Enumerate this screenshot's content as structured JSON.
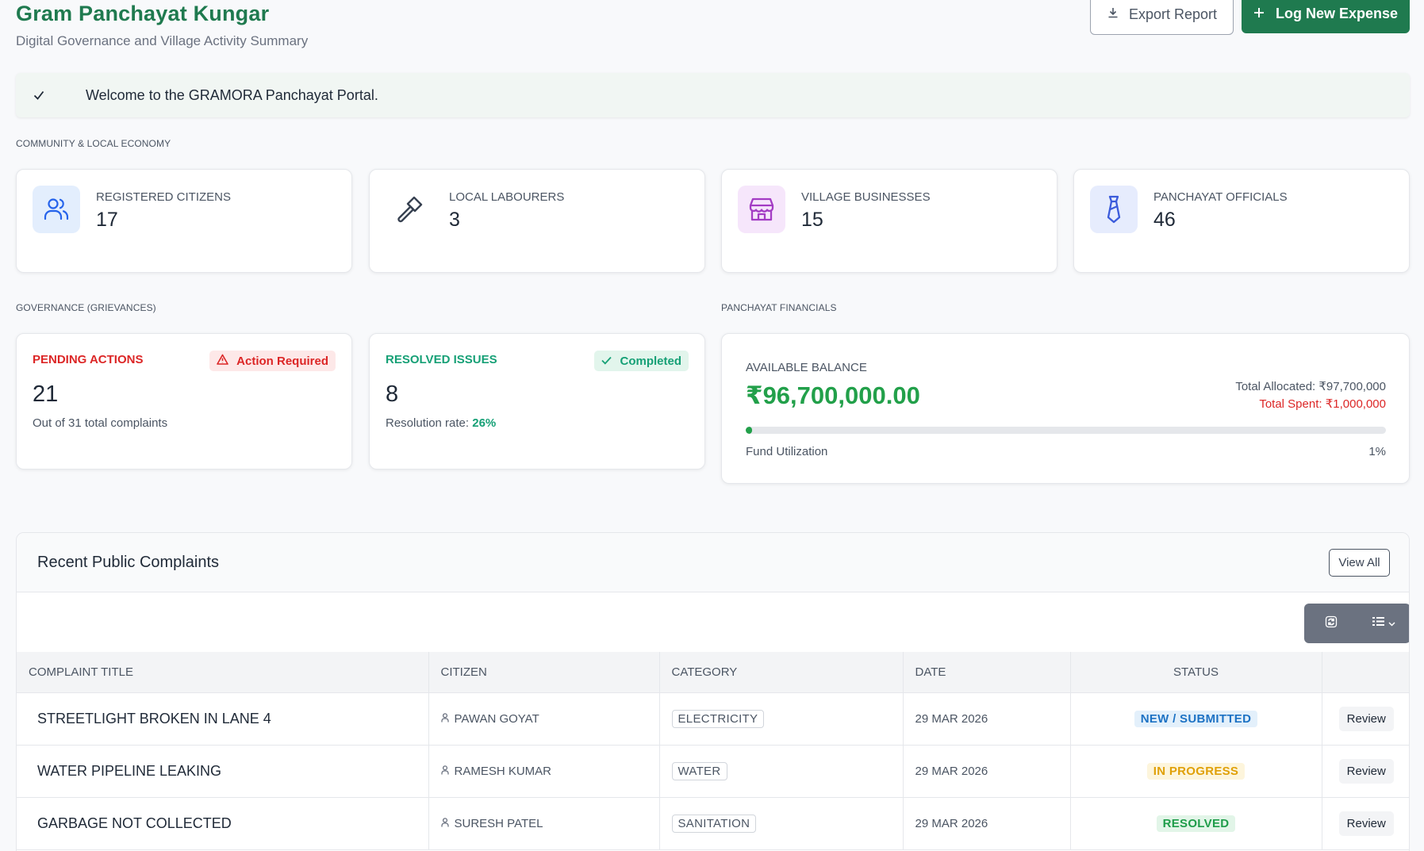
{
  "header": {
    "title": "Gram Panchayat Kungar",
    "subtitle": "Digital Governance and Village Activity Summary",
    "export_label": "Export Report",
    "log_expense_label": "Log New Expense"
  },
  "alert": {
    "message": "Welcome to the GRAMORA Panchayat Portal."
  },
  "community": {
    "section_label": "COMMUNITY & LOCAL ECONOMY",
    "cards": [
      {
        "label": "REGISTERED CITIZENS",
        "value": "17",
        "icon": "users-icon",
        "color": "#2563eb"
      },
      {
        "label": "LOCAL LABOURERS",
        "value": "3",
        "icon": "hammer-icon",
        "color": "#374151"
      },
      {
        "label": "VILLAGE BUSINESSES",
        "value": "15",
        "icon": "store-icon",
        "color": "#a33cc4"
      },
      {
        "label": "PANCHAYAT OFFICIALS",
        "value": "46",
        "icon": "tie-icon",
        "color": "#3b5bdb"
      }
    ]
  },
  "governance": {
    "section_label": "GOVERNANCE (GRIEVANCES)",
    "pending": {
      "label": "PENDING ACTIONS",
      "badge": "Action Required",
      "value": "21",
      "sub": "Out of 31 total complaints"
    },
    "resolved": {
      "label": "RESOLVED ISSUES",
      "badge": "Completed",
      "value": "8",
      "sub_prefix": "Resolution rate: ",
      "rate": "26%"
    }
  },
  "financials": {
    "section_label": "PANCHAYAT FINANCIALS",
    "balance_label": "AVAILABLE BALANCE",
    "balance": "₹96,700,000.00",
    "allocated": "Total Allocated: ₹97,700,000",
    "spent": "Total Spent: ₹1,000,000",
    "utilization_label": "Fund Utilization",
    "utilization_pct": "1%",
    "utilization_value": 1
  },
  "complaints": {
    "title": "Recent Public Complaints",
    "view_all_label": "View All",
    "columns": [
      "COMPLAINT TITLE",
      "CITIZEN",
      "CATEGORY",
      "DATE",
      "STATUS",
      ""
    ],
    "rows": [
      {
        "title": "STREETLIGHT BROKEN IN LANE 4",
        "citizen": "PAWAN GOYAT",
        "category": "ELECTRICITY",
        "date": "29 MAR 2026",
        "status": "NEW / SUBMITTED",
        "status_color": "#1d72c4",
        "status_bg": "#e3f0fb",
        "action": "Review"
      },
      {
        "title": "WATER PIPELINE LEAKING",
        "citizen": "RAMESH KUMAR",
        "category": "WATER",
        "date": "29 MAR 2026",
        "status": "IN PROGRESS",
        "status_color": "#e0a008",
        "status_bg": "#fdf5dc",
        "action": "Review"
      },
      {
        "title": "GARBAGE NOT COLLECTED",
        "citizen": "SURESH PATEL",
        "category": "SANITATION",
        "date": "29 MAR 2026",
        "status": "RESOLVED",
        "status_color": "#1f9d4a",
        "status_bg": "#e2f5e8",
        "action": "Review"
      }
    ]
  },
  "colors": {
    "brand": "#1f7a4f",
    "danger": "#dc2626",
    "success": "#22a04a"
  }
}
